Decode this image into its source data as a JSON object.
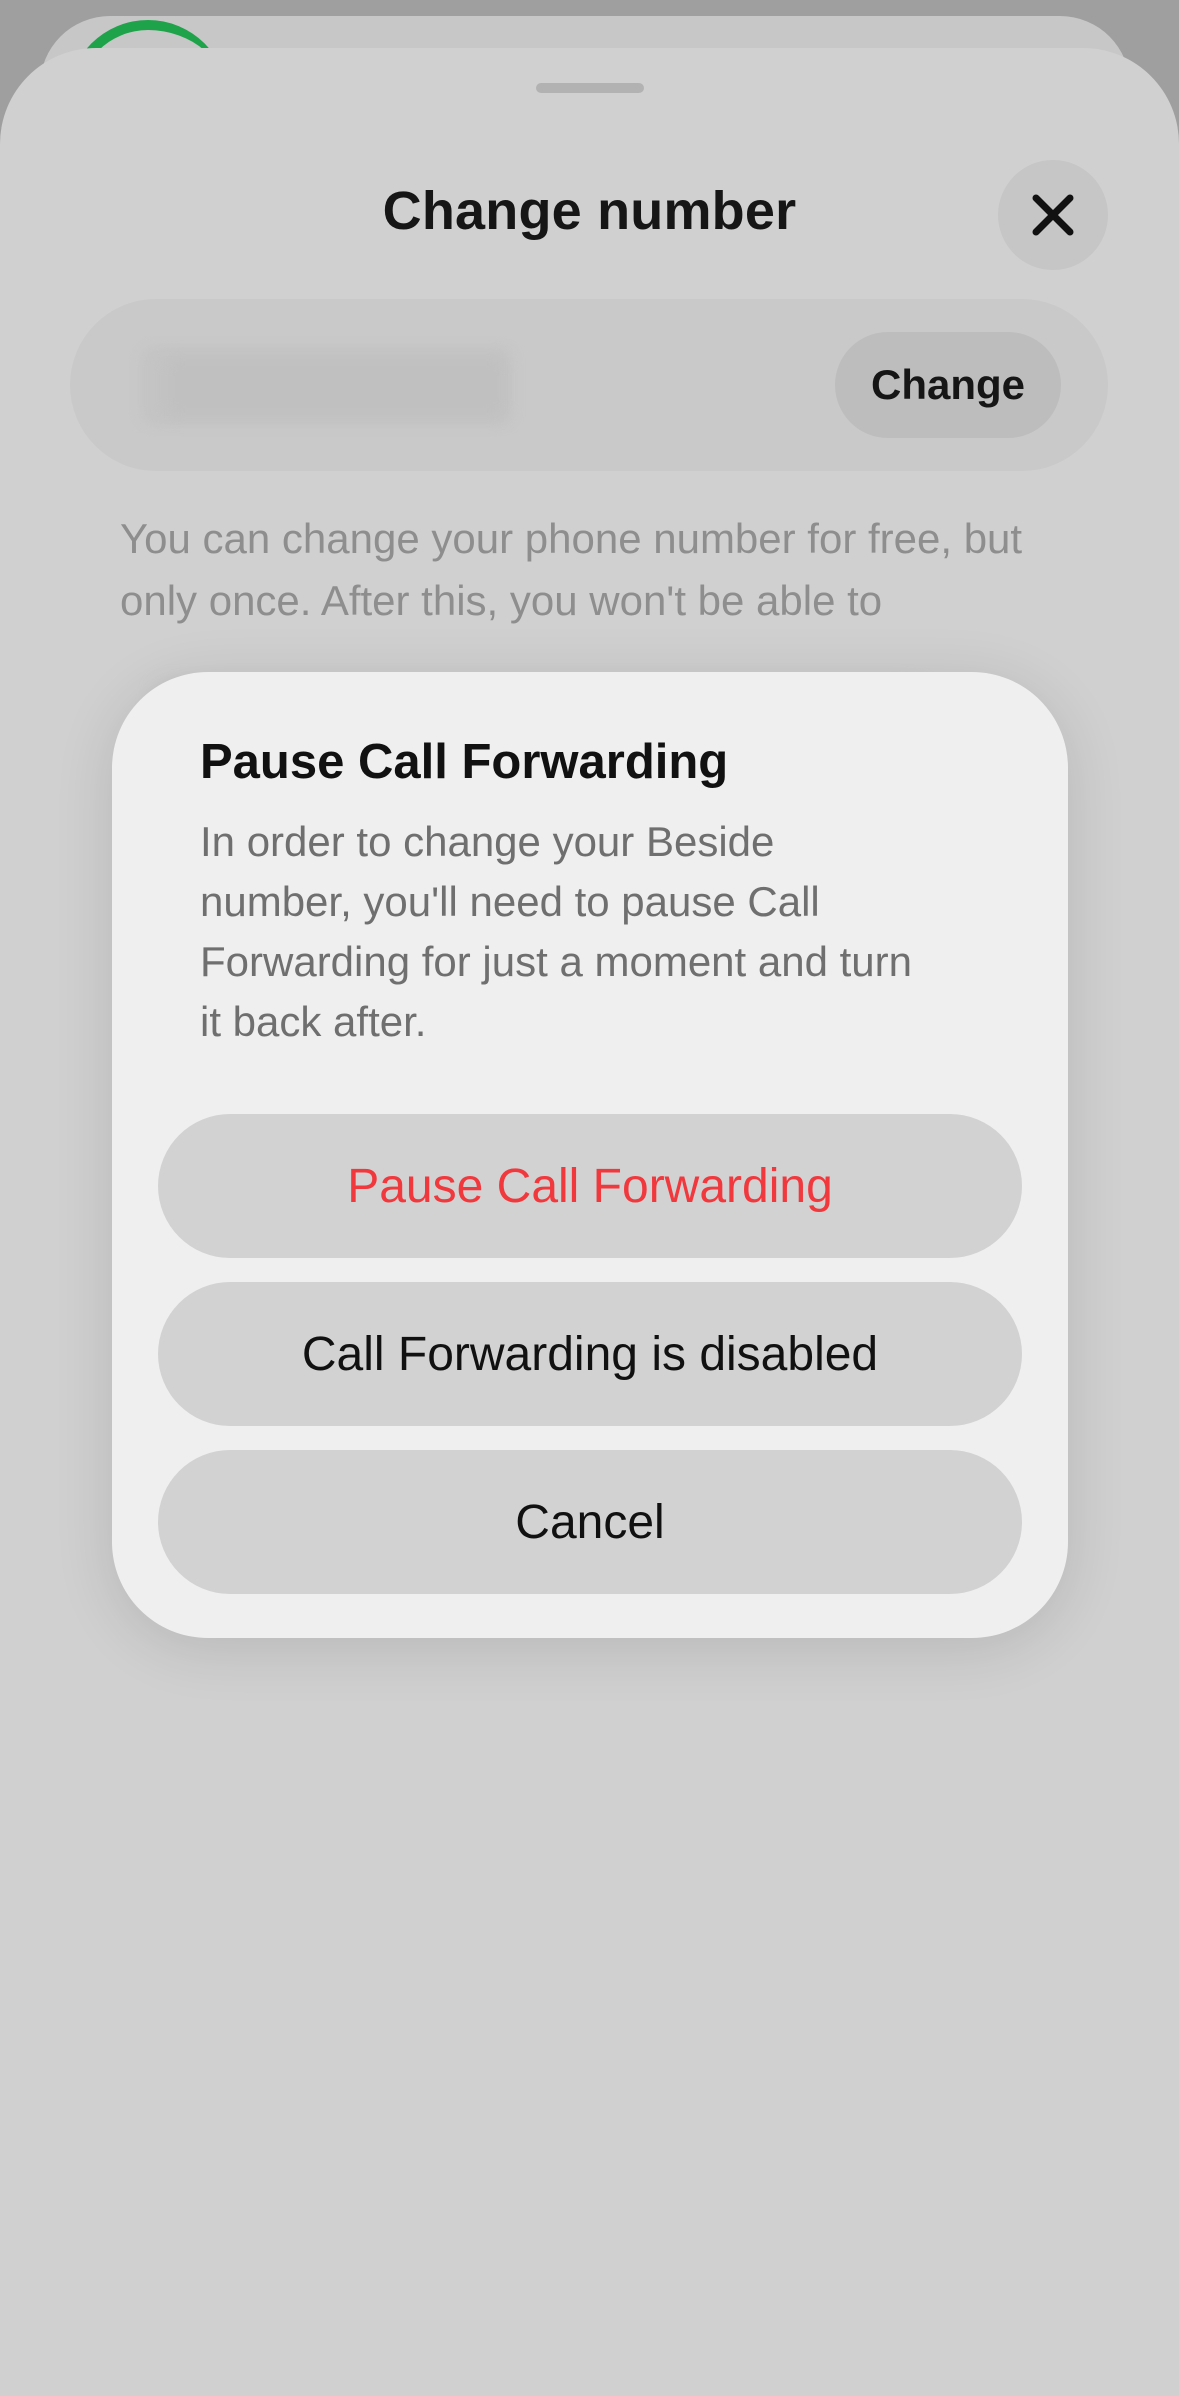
{
  "colors": {
    "destructive": "#f0383d",
    "sheet_background": "#d0d0d0",
    "dialog_background": "#efefef",
    "button_background": "#d2d2d2",
    "accent_green": "#1fa34a"
  },
  "sheet": {
    "title": "Change number",
    "close_icon": "close-icon",
    "change_button_label": "Change",
    "info_text": "You can change your phone number for free, but only once. After this, you won't be able to"
  },
  "dialog": {
    "title": "Pause Call Forwarding",
    "body": "In order to change your Beside number, you'll need to pause Call Forwarding for just a moment and turn it back after.",
    "buttons": {
      "pause": "Pause Call Forwarding",
      "disabled": "Call Forwarding is disabled",
      "cancel": "Cancel"
    }
  }
}
